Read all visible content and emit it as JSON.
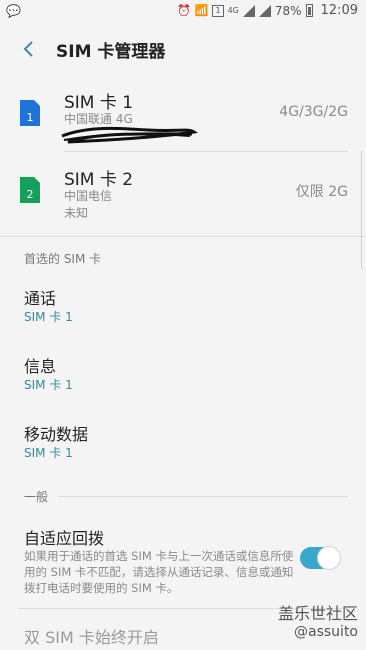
{
  "status_bar": {
    "network_tag": "4G",
    "sim_tag": "1",
    "battery": "78%",
    "time": "12:09"
  },
  "app_bar": {
    "title": "SIM 卡管理器"
  },
  "sims": [
    {
      "name": "SIM 卡 1",
      "carrier": "中国联通 4G",
      "network": "4G/3G/2G",
      "icon_label": "1",
      "color": "#1e73d8"
    },
    {
      "name": "SIM 卡 2",
      "carrier": "中国电信",
      "status": "未知",
      "network": "仅限 2G",
      "icon_label": "2",
      "color": "#14a05a"
    }
  ],
  "preferred": {
    "section_label": "首选的 SIM 卡",
    "items": [
      {
        "title": "通话",
        "value": "SIM 卡 1"
      },
      {
        "title": "信息",
        "value": "SIM 卡 1"
      },
      {
        "title": "移动数据",
        "value": "SIM 卡 1"
      }
    ]
  },
  "general": {
    "section_label": "一般",
    "adaptive": {
      "title": "自适应回拨",
      "description": "如果用于通话的首选 SIM 卡与上一次通话或信息所使用的 SIM 卡不匹配，请选择从通话记录、信息或通知拨打电话时要使用的 SIM 卡。",
      "enabled": true
    },
    "dual_sim_title": "双 SIM 卡始终开启"
  },
  "watermark": {
    "line1": "盖乐世社区",
    "line2": "@assuito"
  },
  "colors": {
    "accent": "#2a8fa4",
    "toggle_on": "#3aa9c9"
  }
}
